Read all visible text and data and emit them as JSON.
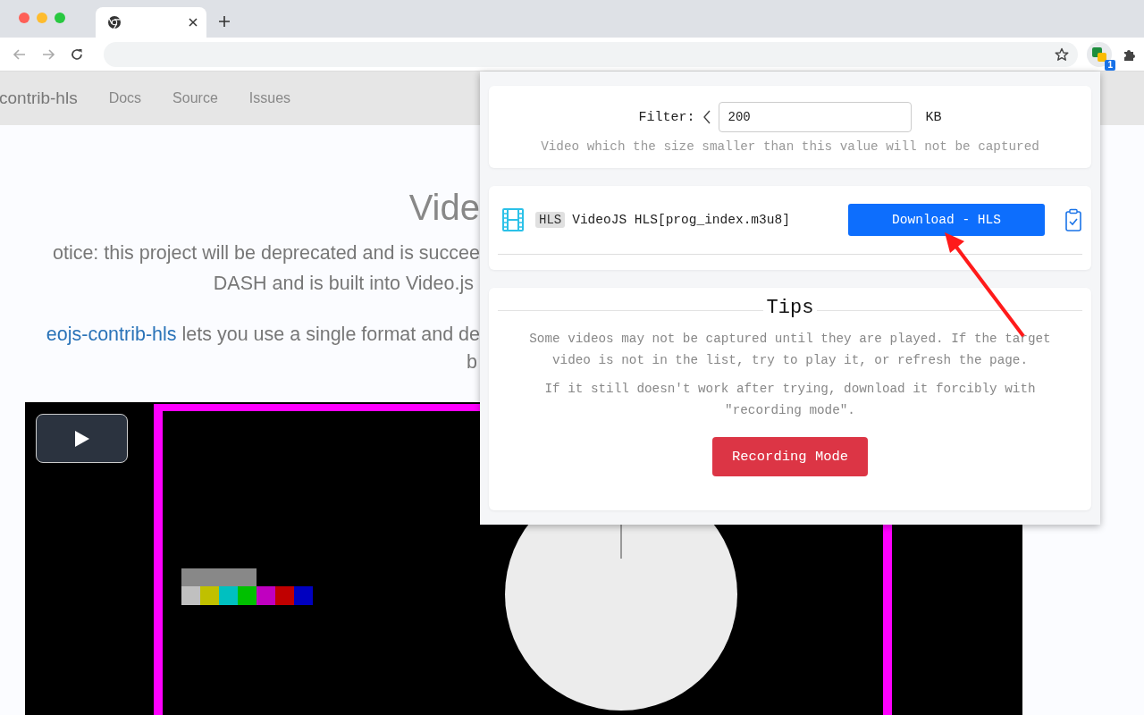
{
  "browser": {
    "extension_badge": "1"
  },
  "page": {
    "nav": {
      "brand": "contrib-hls",
      "links": [
        "Docs",
        "Source",
        "Issues"
      ]
    },
    "heading": "Vide",
    "notice_lines": [
      "otice: this project will be deprecated and is succee",
      "DASH and is built into Video.js "
    ],
    "intro": {
      "link": "eojs-contrib-hls",
      "text": " lets you use a single format and de",
      "next_line": "b"
    },
    "video": {
      "kind": "picture"
    }
  },
  "popup": {
    "filter": {
      "label": "Filter:",
      "value": "200",
      "unit": "KB",
      "hint": "Video which the size smaller than this value will not be captured"
    },
    "items": [
      {
        "tag": "HLS",
        "name": "VideoJS HLS[prog_index.m3u8]",
        "button": "Download - HLS"
      }
    ],
    "tips": {
      "title": "Tips",
      "paragraphs": [
        "Some videos may not be captured until they are played. If the target video is not in the list, try to play it, or refresh the page.",
        "If it still doesn't work after trying, download it forcibly with \"recording mode\"."
      ],
      "button": "Recording Mode"
    }
  }
}
